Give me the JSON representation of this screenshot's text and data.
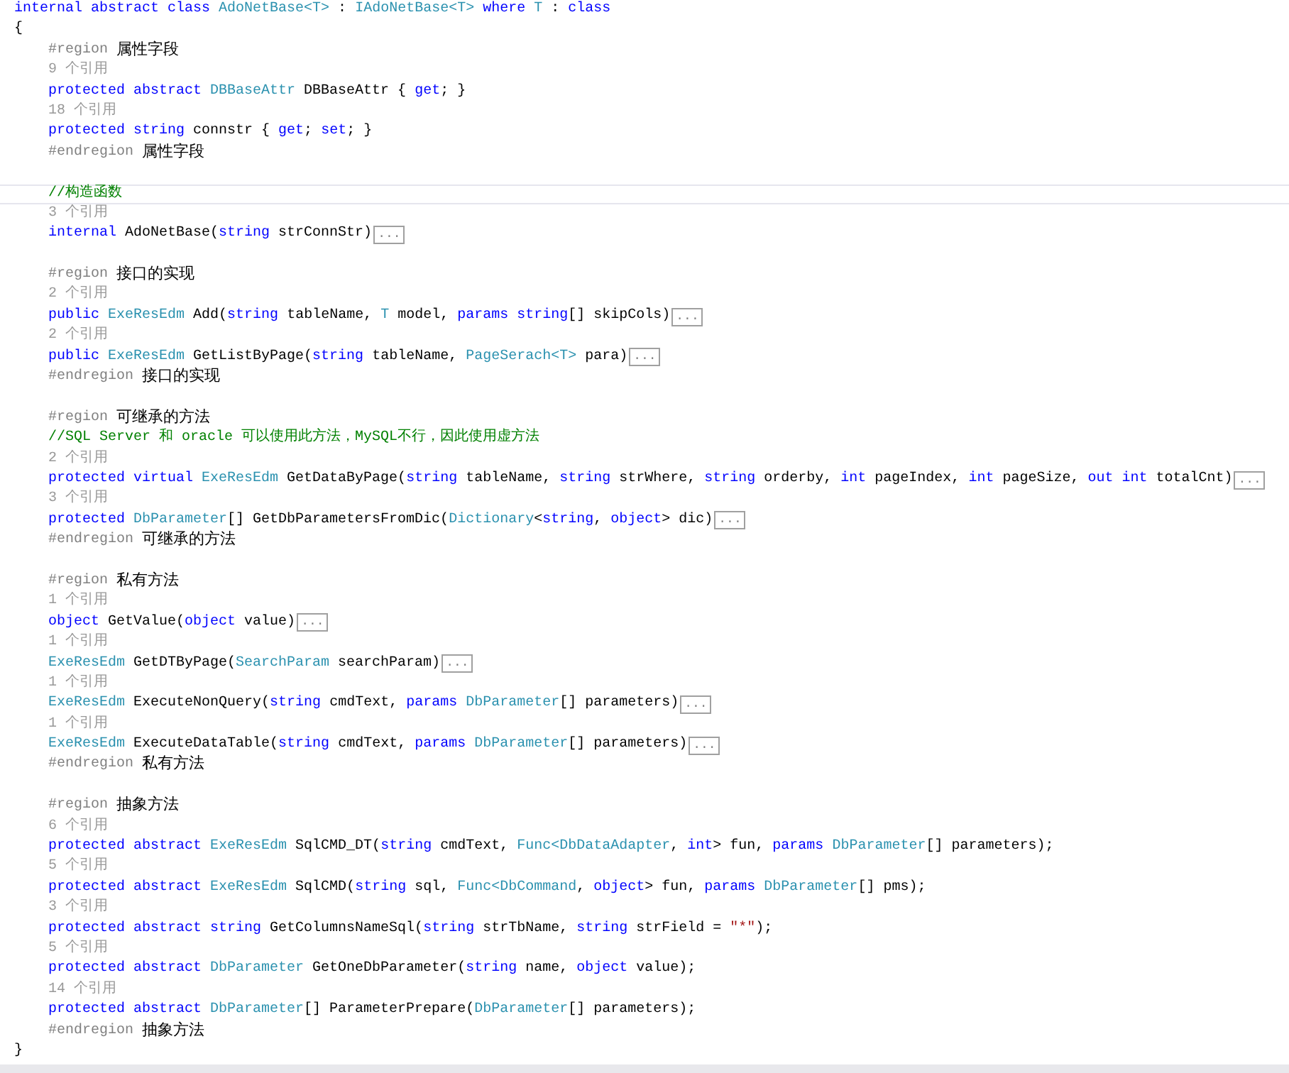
{
  "editor": {
    "header": [
      {
        "kind": "keyword",
        "text": "internal abstract class"
      },
      {
        "kind": "type",
        "text": " AdoNetBase<T>"
      },
      {
        "kind": "plain",
        "text": " :"
      },
      {
        "kind": "type",
        "text": " IAdoNetBase<T>"
      },
      {
        "kind": "keyword",
        "text": " where"
      },
      {
        "kind": "type",
        "text": " T"
      },
      {
        "kind": "plain",
        "text": " :"
      },
      {
        "kind": "keyword",
        "text": " class"
      }
    ],
    "open_brace": "{",
    "body": [
      {
        "kind": "region",
        "directive": "#region",
        "name": "属性字段"
      },
      {
        "kind": "lens",
        "text": "9 个引用"
      },
      {
        "kind": "code",
        "tokens": [
          {
            "kind": "keyword",
            "text": "protected abstract"
          },
          {
            "kind": "type",
            "text": " DBBaseAttr"
          },
          {
            "kind": "plain",
            "text": " DBBaseAttr {"
          },
          {
            "kind": "keyword",
            "text": " get"
          },
          {
            "kind": "plain",
            "text": "; }"
          }
        ]
      },
      {
        "kind": "lens",
        "text": "18 个引用"
      },
      {
        "kind": "code",
        "tokens": [
          {
            "kind": "keyword",
            "text": "protected string"
          },
          {
            "kind": "plain",
            "text": " connstr {"
          },
          {
            "kind": "keyword",
            "text": " get"
          },
          {
            "kind": "plain",
            "text": ";"
          },
          {
            "kind": "keyword",
            "text": " set"
          },
          {
            "kind": "plain",
            "text": "; }"
          }
        ]
      },
      {
        "kind": "region",
        "directive": "#endregion",
        "name": "属性字段"
      },
      {
        "kind": "blank"
      },
      {
        "kind": "section_comment",
        "text": "//构造函数"
      },
      {
        "kind": "lens",
        "text": "3 个引用"
      },
      {
        "kind": "code",
        "tokens": [
          {
            "kind": "keyword",
            "text": "internal"
          },
          {
            "kind": "plain",
            "text": " AdoNetBase("
          },
          {
            "kind": "keyword",
            "text": "string"
          },
          {
            "kind": "plain",
            "text": " strConnStr)"
          }
        ],
        "collapsed": "..."
      },
      {
        "kind": "blank"
      },
      {
        "kind": "region",
        "directive": "#region",
        "name": "接口的实现"
      },
      {
        "kind": "lens",
        "text": "2 个引用"
      },
      {
        "kind": "code",
        "tokens": [
          {
            "kind": "keyword",
            "text": "public"
          },
          {
            "kind": "type",
            "text": " ExeResEdm"
          },
          {
            "kind": "plain",
            "text": " Add("
          },
          {
            "kind": "keyword",
            "text": "string"
          },
          {
            "kind": "plain",
            "text": " tableName,"
          },
          {
            "kind": "type",
            "text": " T"
          },
          {
            "kind": "plain",
            "text": " model,"
          },
          {
            "kind": "keyword",
            "text": " params string"
          },
          {
            "kind": "plain",
            "text": "[] skipCols)"
          }
        ],
        "collapsed": "..."
      },
      {
        "kind": "lens",
        "text": "2 个引用"
      },
      {
        "kind": "code",
        "tokens": [
          {
            "kind": "keyword",
            "text": "public"
          },
          {
            "kind": "type",
            "text": " ExeResEdm"
          },
          {
            "kind": "plain",
            "text": " GetListByPage("
          },
          {
            "kind": "keyword",
            "text": "string"
          },
          {
            "kind": "plain",
            "text": " tableName,"
          },
          {
            "kind": "type",
            "text": " PageSerach<T>"
          },
          {
            "kind": "plain",
            "text": " para)"
          }
        ],
        "collapsed": "..."
      },
      {
        "kind": "region",
        "directive": "#endregion",
        "name": "接口的实现"
      },
      {
        "kind": "blank"
      },
      {
        "kind": "region",
        "directive": "#region",
        "name": "可继承的方法"
      },
      {
        "kind": "comment",
        "text": "//SQL Server 和 oracle 可以使用此方法，MySQL不行，因此使用虚方法"
      },
      {
        "kind": "lens",
        "text": "2 个引用"
      },
      {
        "kind": "code",
        "tokens": [
          {
            "kind": "keyword",
            "text": "protected virtual"
          },
          {
            "kind": "type",
            "text": " ExeResEdm"
          },
          {
            "kind": "plain",
            "text": " GetDataByPage("
          },
          {
            "kind": "keyword",
            "text": "string"
          },
          {
            "kind": "plain",
            "text": " tableName,"
          },
          {
            "kind": "keyword",
            "text": " string"
          },
          {
            "kind": "plain",
            "text": " strWhere,"
          },
          {
            "kind": "keyword",
            "text": " string"
          },
          {
            "kind": "plain",
            "text": " orderby,"
          },
          {
            "kind": "keyword",
            "text": " int"
          },
          {
            "kind": "plain",
            "text": " pageIndex,"
          },
          {
            "kind": "keyword",
            "text": " int"
          },
          {
            "kind": "plain",
            "text": " pageSize,"
          },
          {
            "kind": "keyword",
            "text": " out int"
          },
          {
            "kind": "plain",
            "text": " totalCnt)"
          }
        ],
        "collapsed": "..."
      },
      {
        "kind": "lens",
        "text": "3 个引用"
      },
      {
        "kind": "code",
        "tokens": [
          {
            "kind": "keyword",
            "text": "protected"
          },
          {
            "kind": "type",
            "text": " DbParameter"
          },
          {
            "kind": "plain",
            "text": "[] GetDbParametersFromDic("
          },
          {
            "kind": "type",
            "text": "Dictionary"
          },
          {
            "kind": "plain",
            "text": "<"
          },
          {
            "kind": "keyword",
            "text": "string"
          },
          {
            "kind": "plain",
            "text": ","
          },
          {
            "kind": "keyword",
            "text": " object"
          },
          {
            "kind": "plain",
            "text": "> dic)"
          }
        ],
        "collapsed": "..."
      },
      {
        "kind": "region",
        "directive": "#endregion",
        "name": "可继承的方法"
      },
      {
        "kind": "blank"
      },
      {
        "kind": "region",
        "directive": "#region",
        "name": "私有方法"
      },
      {
        "kind": "lens",
        "text": "1 个引用"
      },
      {
        "kind": "code",
        "tokens": [
          {
            "kind": "keyword",
            "text": "object"
          },
          {
            "kind": "plain",
            "text": " GetValue("
          },
          {
            "kind": "keyword",
            "text": "object"
          },
          {
            "kind": "plain",
            "text": " value)"
          }
        ],
        "collapsed": "..."
      },
      {
        "kind": "lens",
        "text": "1 个引用"
      },
      {
        "kind": "code",
        "tokens": [
          {
            "kind": "type",
            "text": "ExeResEdm"
          },
          {
            "kind": "plain",
            "text": " GetDTByPage("
          },
          {
            "kind": "type",
            "text": "SearchParam"
          },
          {
            "kind": "plain",
            "text": " searchParam)"
          }
        ],
        "collapsed": "..."
      },
      {
        "kind": "lens",
        "text": "1 个引用"
      },
      {
        "kind": "code",
        "tokens": [
          {
            "kind": "type",
            "text": "ExeResEdm"
          },
          {
            "kind": "plain",
            "text": " ExecuteNonQuery("
          },
          {
            "kind": "keyword",
            "text": "string"
          },
          {
            "kind": "plain",
            "text": " cmdText,"
          },
          {
            "kind": "keyword",
            "text": " params"
          },
          {
            "kind": "type",
            "text": " DbParameter"
          },
          {
            "kind": "plain",
            "text": "[] parameters)"
          }
        ],
        "collapsed": "..."
      },
      {
        "kind": "lens",
        "text": "1 个引用"
      },
      {
        "kind": "code",
        "tokens": [
          {
            "kind": "type",
            "text": "ExeResEdm"
          },
          {
            "kind": "plain",
            "text": " ExecuteDataTable("
          },
          {
            "kind": "keyword",
            "text": "string"
          },
          {
            "kind": "plain",
            "text": " cmdText,"
          },
          {
            "kind": "keyword",
            "text": " params"
          },
          {
            "kind": "type",
            "text": " DbParameter"
          },
          {
            "kind": "plain",
            "text": "[] parameters)"
          }
        ],
        "collapsed": "..."
      },
      {
        "kind": "region",
        "directive": "#endregion",
        "name": "私有方法"
      },
      {
        "kind": "blank"
      },
      {
        "kind": "region",
        "directive": "#region",
        "name": "抽象方法"
      },
      {
        "kind": "lens",
        "text": "6 个引用"
      },
      {
        "kind": "code",
        "tokens": [
          {
            "kind": "keyword",
            "text": "protected abstract"
          },
          {
            "kind": "type",
            "text": " ExeResEdm"
          },
          {
            "kind": "plain",
            "text": " SqlCMD_DT("
          },
          {
            "kind": "keyword",
            "text": "string"
          },
          {
            "kind": "plain",
            "text": " cmdText,"
          },
          {
            "kind": "type",
            "text": " Func<DbDataAdapter"
          },
          {
            "kind": "plain",
            "text": ","
          },
          {
            "kind": "keyword",
            "text": " int"
          },
          {
            "kind": "plain",
            "text": "> fun,"
          },
          {
            "kind": "keyword",
            "text": " params"
          },
          {
            "kind": "type",
            "text": " DbParameter"
          },
          {
            "kind": "plain",
            "text": "[] parameters);"
          }
        ]
      },
      {
        "kind": "lens",
        "text": "5 个引用"
      },
      {
        "kind": "code",
        "tokens": [
          {
            "kind": "keyword",
            "text": "protected abstract"
          },
          {
            "kind": "type",
            "text": " ExeResEdm"
          },
          {
            "kind": "plain",
            "text": " SqlCMD("
          },
          {
            "kind": "keyword",
            "text": "string"
          },
          {
            "kind": "plain",
            "text": " sql,"
          },
          {
            "kind": "type",
            "text": " Func<DbCommand"
          },
          {
            "kind": "plain",
            "text": ","
          },
          {
            "kind": "keyword",
            "text": " object"
          },
          {
            "kind": "plain",
            "text": "> fun,"
          },
          {
            "kind": "keyword",
            "text": " params"
          },
          {
            "kind": "type",
            "text": " DbParameter"
          },
          {
            "kind": "plain",
            "text": "[] pms);"
          }
        ]
      },
      {
        "kind": "lens",
        "text": "3 个引用"
      },
      {
        "kind": "code",
        "tokens": [
          {
            "kind": "keyword",
            "text": "protected abstract string"
          },
          {
            "kind": "plain",
            "text": " GetColumnsNameSql("
          },
          {
            "kind": "keyword",
            "text": "string"
          },
          {
            "kind": "plain",
            "text": " strTbName,"
          },
          {
            "kind": "keyword",
            "text": " string"
          },
          {
            "kind": "plain",
            "text": " strField = "
          },
          {
            "kind": "string",
            "text": "\"*\""
          },
          {
            "kind": "plain",
            "text": ");"
          }
        ]
      },
      {
        "kind": "lens",
        "text": "5 个引用"
      },
      {
        "kind": "code",
        "tokens": [
          {
            "kind": "keyword",
            "text": "protected abstract"
          },
          {
            "kind": "type",
            "text": " DbParameter"
          },
          {
            "kind": "plain",
            "text": " GetOneDbParameter("
          },
          {
            "kind": "keyword",
            "text": "string"
          },
          {
            "kind": "plain",
            "text": " name,"
          },
          {
            "kind": "keyword",
            "text": " object"
          },
          {
            "kind": "plain",
            "text": " value);"
          }
        ]
      },
      {
        "kind": "lens",
        "text": "14 个引用"
      },
      {
        "kind": "code",
        "tokens": [
          {
            "kind": "keyword",
            "text": "protected abstract"
          },
          {
            "kind": "type",
            "text": " DbParameter"
          },
          {
            "kind": "plain",
            "text": "[] ParameterPrepare("
          },
          {
            "kind": "type",
            "text": "DbParameter"
          },
          {
            "kind": "plain",
            "text": "[] parameters);"
          }
        ]
      },
      {
        "kind": "region",
        "directive": "#endregion",
        "name": "抽象方法"
      }
    ],
    "close_brace": "}"
  }
}
